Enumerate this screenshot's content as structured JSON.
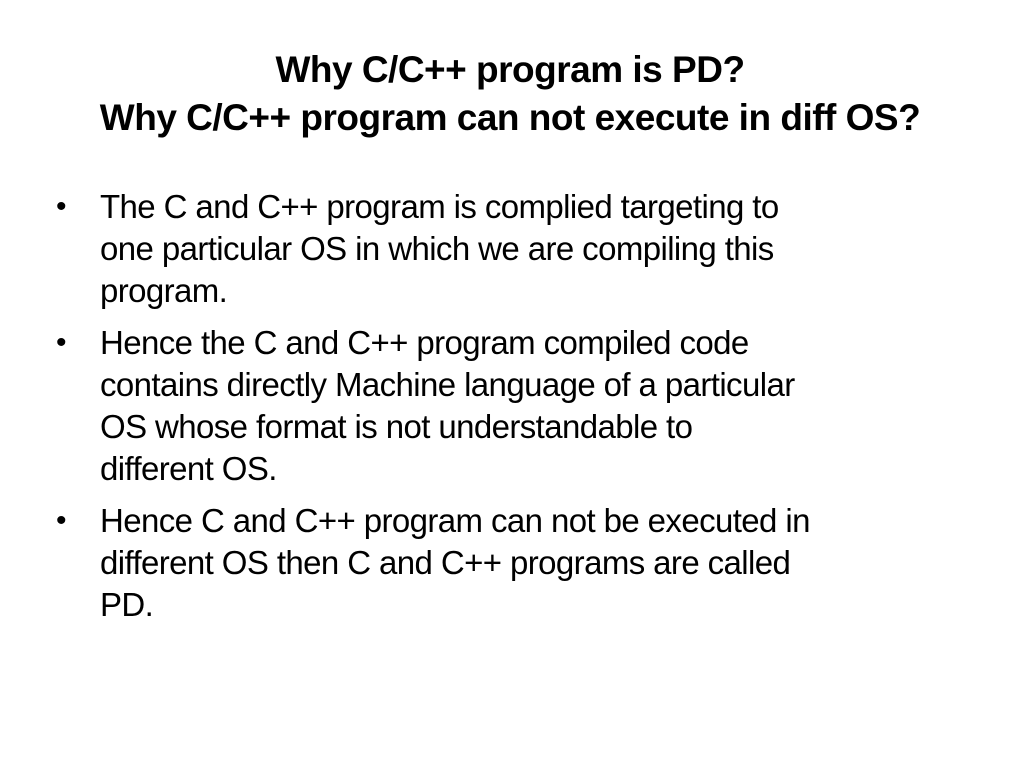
{
  "slide": {
    "title_lines": [
      "Why C/C++ program is PD?",
      "Why C/C++ program can not execute in diff OS?"
    ],
    "bullet_symbol": "•",
    "bullets": [
      {
        "lines": [
          "The C and C++ program is complied targeting to",
          "one particular OS in which we are compiling this",
          "program."
        ]
      },
      {
        "lines": [
          "Hence the C and C++ program compiled code",
          "contains directly Machine language of a particular",
          "OS whose format is not understandable to",
          "different OS."
        ]
      },
      {
        "lines": [
          "Hence C and C++ program can not be executed in",
          "different OS then C and C++ programs are called",
          "PD."
        ]
      }
    ]
  }
}
